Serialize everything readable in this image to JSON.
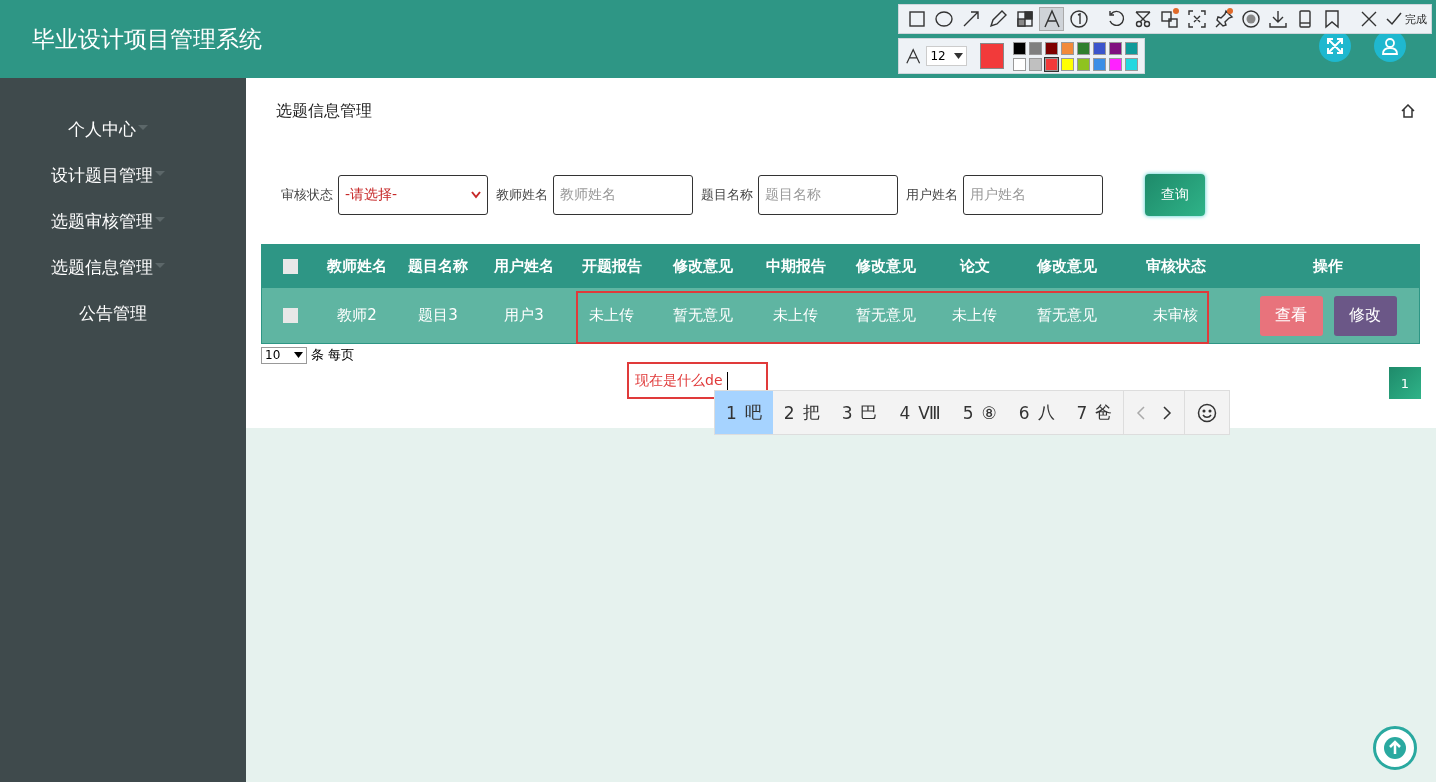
{
  "header": {
    "title": "毕业设计项目管理系统"
  },
  "sidebar": {
    "items": [
      {
        "label": "个人中心",
        "has_submenu": true
      },
      {
        "label": "设计题目管理",
        "has_submenu": true
      },
      {
        "label": "选题审核管理",
        "has_submenu": true
      },
      {
        "label": "选题信息管理",
        "has_submenu": true
      },
      {
        "label": "公告管理",
        "has_submenu": false
      }
    ]
  },
  "page": {
    "title": "选题信息管理"
  },
  "search": {
    "fields": [
      {
        "kind": "select",
        "label": "审核状态",
        "value": "-请选择-"
      },
      {
        "kind": "input",
        "label": "教师姓名",
        "placeholder": "教师姓名"
      },
      {
        "kind": "input",
        "label": "题目名称",
        "placeholder": "题目名称"
      },
      {
        "kind": "input",
        "label": "用户姓名",
        "placeholder": "用户姓名"
      }
    ],
    "button": "查询"
  },
  "table": {
    "select_all_checked": false,
    "columns": [
      "教师姓名",
      "题目名称",
      "用户姓名",
      "开题报告",
      "修改意见",
      "中期报告",
      "修改意见",
      "论文",
      "修改意见",
      "审核状态",
      "操作"
    ],
    "rows": [
      {
        "checked": false,
        "cells": [
          "教师2",
          "题目3",
          "用户3",
          "未上传",
          "暂无意见",
          "未上传",
          "暂无意见",
          "未上传",
          "暂无意见",
          "未审核"
        ],
        "actions": [
          {
            "kind": "view",
            "label": "查看"
          },
          {
            "kind": "edit",
            "label": "修改"
          }
        ]
      }
    ]
  },
  "pager": {
    "page_size": "10",
    "page_size_label": "条 每页",
    "pages": [
      {
        "label": "1",
        "selected": true
      }
    ]
  },
  "annotation_toolbar": {
    "tool_groups": [
      {
        "tools": [
          {
            "kind": "rectangle",
            "selected": false
          },
          {
            "kind": "ellipse",
            "selected": false
          },
          {
            "kind": "arrow",
            "selected": false
          },
          {
            "kind": "pen",
            "selected": false
          },
          {
            "kind": "mosaic",
            "selected": false
          },
          {
            "kind": "text",
            "selected": true
          },
          {
            "kind": "number",
            "selected": false
          }
        ]
      },
      {
        "tools": [
          {
            "kind": "undo",
            "selected": false
          },
          {
            "kind": "cut",
            "selected": false
          },
          {
            "kind": "translate",
            "selected": false,
            "badge": true
          },
          {
            "kind": "ocr",
            "selected": false
          },
          {
            "kind": "pin",
            "selected": false,
            "badge": true
          },
          {
            "kind": "record",
            "selected": false
          },
          {
            "kind": "download",
            "selected": false
          },
          {
            "kind": "phone",
            "selected": false
          },
          {
            "kind": "bookmark",
            "selected": false
          }
        ]
      },
      {
        "tools": [
          {
            "kind": "close",
            "selected": false
          }
        ]
      }
    ],
    "done_label": "完成",
    "font_size": "12",
    "swatches": [
      {
        "color": "#000000",
        "selected": false
      },
      {
        "color": "#7f7f7f",
        "selected": false
      },
      {
        "color": "#7f0000",
        "selected": false
      },
      {
        "color": "#f28a3a",
        "selected": false
      },
      {
        "color": "#2f7f2f",
        "selected": false
      },
      {
        "color": "#3b55cc",
        "selected": false
      },
      {
        "color": "#7f0f7f",
        "selected": false
      },
      {
        "color": "#0f9a9a",
        "selected": false
      },
      {
        "color": "#ffffff",
        "selected": false
      },
      {
        "color": "#c0c0c0",
        "selected": false
      },
      {
        "color": "#f23a3a",
        "selected": true
      },
      {
        "color": "#ffff00",
        "selected": false
      },
      {
        "color": "#8fc31f",
        "selected": false
      },
      {
        "color": "#3a8ee6",
        "selected": false
      },
      {
        "color": "#ff22ff",
        "selected": false
      },
      {
        "color": "#22d8e0",
        "selected": false
      }
    ]
  },
  "annotation_text": {
    "text": "现在是什么de"
  },
  "ime": {
    "candidates": [
      {
        "index": "1",
        "text": "吧",
        "selected": true
      },
      {
        "index": "2",
        "text": "把",
        "selected": false
      },
      {
        "index": "3",
        "text": "巴",
        "selected": false
      },
      {
        "index": "4",
        "text": "Ⅷ",
        "selected": false
      },
      {
        "index": "5",
        "text": "⑧",
        "selected": false
      },
      {
        "index": "6",
        "text": "八",
        "selected": false
      },
      {
        "index": "7",
        "text": "爸",
        "selected": false
      }
    ]
  }
}
